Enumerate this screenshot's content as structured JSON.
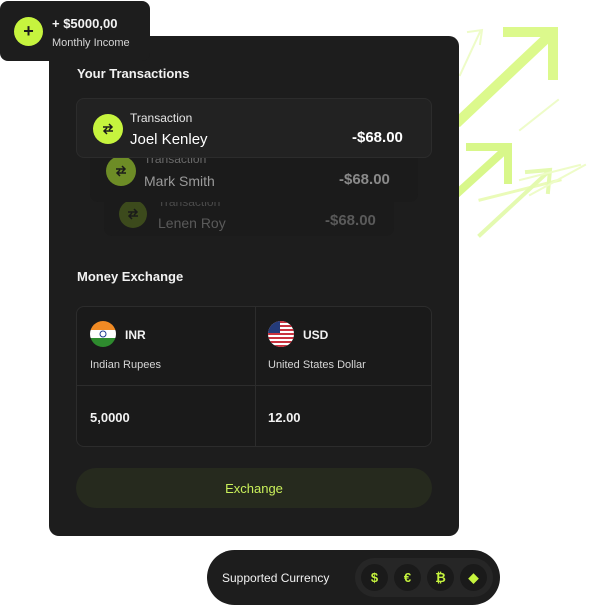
{
  "income": {
    "amount": "+ $5000,00",
    "label": "Monthly Income",
    "icon": "plus-icon"
  },
  "transactions_section": {
    "title": "Your Transactions",
    "items": [
      {
        "label": "Transaction",
        "name": "Joel Kenley",
        "amount": "-$68.00",
        "icon": "swap-icon"
      },
      {
        "label": "Transaction",
        "name": "Mark Smith",
        "amount": "-$68.00",
        "icon": "swap-icon"
      },
      {
        "label": "Transaction",
        "name": "Lenen Roy",
        "amount": "-$68.00",
        "icon": "swap-icon"
      }
    ]
  },
  "exchange_section": {
    "title": "Money Exchange",
    "from": {
      "code": "INR",
      "name": "Indian Rupees",
      "amount": "5,0000",
      "flag": "india-flag-icon"
    },
    "to": {
      "code": "USD",
      "name": "United States Dollar",
      "amount": "12.00",
      "flag": "usa-flag-icon"
    },
    "button_label": "Exchange"
  },
  "supported": {
    "label": "Supported Currency",
    "coins": [
      {
        "symbol": "$",
        "icon": "dollar-icon"
      },
      {
        "symbol": "€",
        "icon": "euro-icon"
      },
      {
        "symbol": "₿",
        "icon": "bitcoin-icon"
      },
      {
        "symbol": "◆",
        "icon": "ethereum-icon"
      }
    ]
  },
  "colors": {
    "accent": "#c6f43e",
    "card": "#1d1d1d",
    "button_bg": "#262a1e"
  }
}
